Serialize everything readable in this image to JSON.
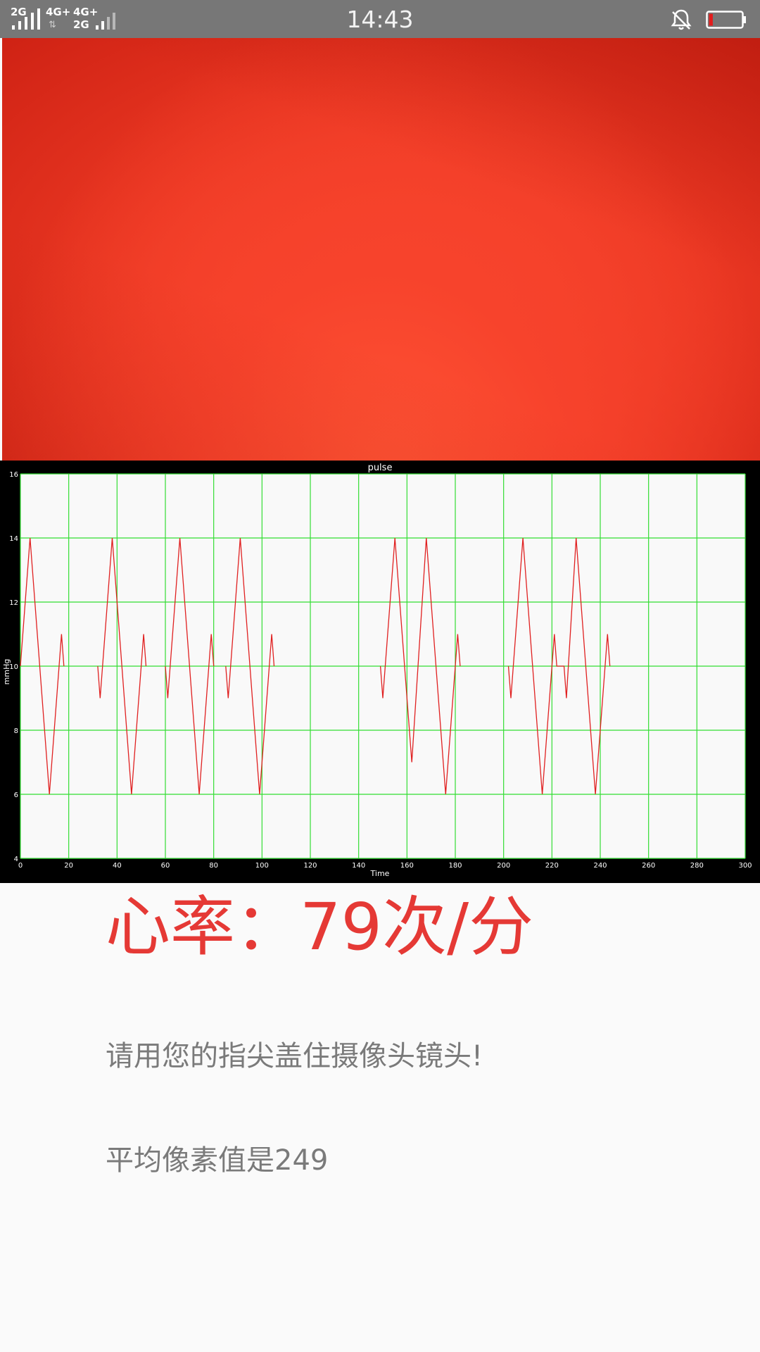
{
  "status_bar": {
    "time": "14:43",
    "sim1_label": "2G",
    "sim2_label_top": "4G+",
    "sim2_label_bottom": "",
    "sim3_label_top": "4G+",
    "sim3_label_bottom": "2G",
    "icons": [
      "signal-icon",
      "bell-off-icon",
      "battery-low-icon"
    ],
    "battery_level": 0.12,
    "battery_color": "#e31c1c"
  },
  "camera_preview": {
    "color": "#f2442c"
  },
  "chart_data": {
    "type": "line",
    "title": "pulse",
    "xlabel": "Time",
    "ylabel": "mmHg",
    "xlim": [
      0,
      300
    ],
    "ylim": [
      4,
      16
    ],
    "x_ticks": [
      0,
      20,
      40,
      60,
      80,
      100,
      120,
      140,
      160,
      180,
      200,
      220,
      240,
      260,
      280,
      300
    ],
    "y_ticks": [
      4,
      6,
      8,
      10,
      12,
      14,
      16
    ],
    "grid": true,
    "grid_color": "#33dd33",
    "plot_background": "#f9f9f9",
    "line_color": "#e02020",
    "segments": [
      [
        [
          0,
          10
        ],
        [
          4,
          14
        ],
        [
          12,
          6
        ],
        [
          17,
          11
        ],
        [
          18,
          10
        ]
      ],
      [
        [
          32,
          10
        ],
        [
          33,
          9
        ],
        [
          38,
          14
        ],
        [
          46,
          6
        ],
        [
          51,
          11
        ],
        [
          52,
          10
        ]
      ],
      [
        [
          60,
          10
        ],
        [
          61,
          9
        ],
        [
          66,
          14
        ],
        [
          74,
          6
        ],
        [
          79,
          11
        ],
        [
          80,
          10
        ]
      ],
      [
        [
          85,
          10
        ],
        [
          86,
          9
        ],
        [
          91,
          14
        ],
        [
          99,
          6
        ],
        [
          104,
          11
        ],
        [
          105,
          10
        ]
      ],
      [
        [
          149,
          10
        ],
        [
          150,
          9
        ],
        [
          155,
          14
        ],
        [
          162,
          7
        ],
        [
          168,
          14
        ],
        [
          176,
          6
        ],
        [
          181,
          11
        ],
        [
          182,
          10
        ]
      ],
      [
        [
          202,
          10
        ],
        [
          203,
          9
        ],
        [
          208,
          14
        ],
        [
          216,
          6
        ],
        [
          221,
          11
        ],
        [
          222,
          10
        ],
        [
          225,
          10
        ],
        [
          226,
          9
        ],
        [
          230,
          14
        ],
        [
          238,
          6
        ],
        [
          243,
          11
        ],
        [
          244,
          10
        ]
      ]
    ]
  },
  "heart_rate": {
    "text": "心率：79次/分",
    "color": "#e53935"
  },
  "hint": {
    "text": "请用您的指尖盖住摄像头镜头!"
  },
  "avg_pixel": {
    "text": "平均像素值是249"
  }
}
